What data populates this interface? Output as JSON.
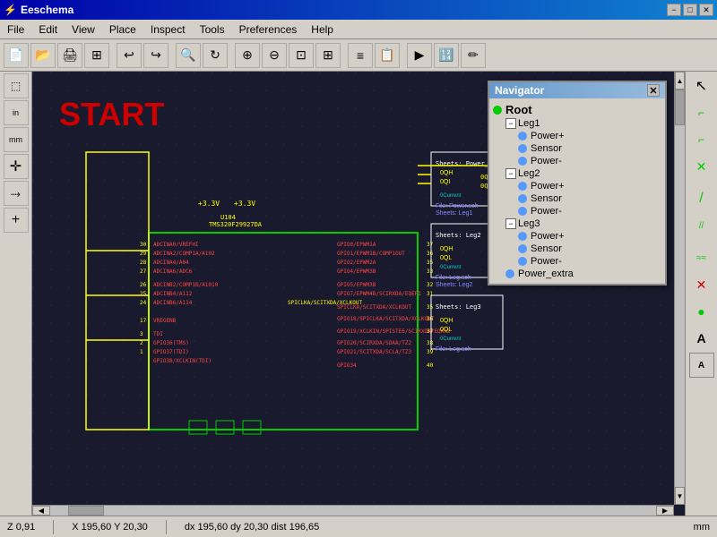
{
  "titlebar": {
    "title": "Eeschema",
    "min_btn": "−",
    "max_btn": "□",
    "close_btn": "✕"
  },
  "menubar": {
    "items": [
      "File",
      "Edit",
      "View",
      "Place",
      "Inspect",
      "Tools",
      "Preferences",
      "Help"
    ]
  },
  "toolbar": {
    "buttons": [
      {
        "name": "new",
        "icon": "📄"
      },
      {
        "name": "open",
        "icon": "📂"
      },
      {
        "name": "print",
        "icon": "🖨"
      },
      {
        "name": "copy",
        "icon": "⊞"
      },
      {
        "name": "sep1",
        "icon": ""
      },
      {
        "name": "undo",
        "icon": "↩"
      },
      {
        "name": "redo",
        "icon": "↪"
      },
      {
        "name": "sep2",
        "icon": ""
      },
      {
        "name": "search",
        "icon": "🔍"
      },
      {
        "name": "refresh",
        "icon": "↻"
      },
      {
        "name": "sep3",
        "icon": ""
      },
      {
        "name": "zoom-in",
        "icon": "⊕"
      },
      {
        "name": "zoom-out",
        "icon": "⊖"
      },
      {
        "name": "zoom-fit",
        "icon": "⊡"
      },
      {
        "name": "zoom-sel",
        "icon": "⊞"
      },
      {
        "name": "sep4",
        "icon": ""
      },
      {
        "name": "netlist",
        "icon": "≡"
      },
      {
        "name": "bom",
        "icon": "📋"
      },
      {
        "name": "sep5",
        "icon": ""
      },
      {
        "name": "erc",
        "icon": "▶"
      },
      {
        "name": "annotate",
        "icon": "🔢"
      },
      {
        "name": "edit-fields",
        "icon": "✏"
      }
    ]
  },
  "left_toolbar": {
    "buttons": [
      {
        "name": "select",
        "icon": "⬚"
      },
      {
        "name": "unit-in",
        "icon": "in"
      },
      {
        "name": "unit-mm",
        "icon": "mm"
      },
      {
        "name": "sep1",
        "icon": ""
      },
      {
        "name": "move",
        "icon": "✛"
      },
      {
        "name": "wire",
        "icon": "→"
      },
      {
        "name": "add-junction",
        "icon": "+"
      }
    ]
  },
  "right_toolbar": {
    "buttons": [
      {
        "name": "cursor",
        "icon": "↖"
      },
      {
        "name": "wire-tool",
        "icon": "⌐"
      },
      {
        "name": "bus-tool",
        "icon": "⌐"
      },
      {
        "name": "no-connect",
        "icon": "✕"
      },
      {
        "name": "sep1",
        "icon": ""
      },
      {
        "name": "add-wire",
        "icon": "/"
      },
      {
        "name": "add-bus",
        "icon": "//"
      },
      {
        "name": "sep2",
        "icon": ""
      },
      {
        "name": "add-global",
        "icon": "≈"
      },
      {
        "name": "cross",
        "icon": "✕"
      },
      {
        "name": "dot",
        "icon": "●"
      },
      {
        "name": "text",
        "icon": "A"
      },
      {
        "name": "text2",
        "icon": "A"
      }
    ]
  },
  "navigator": {
    "title": "Navigator",
    "close_label": "✕",
    "items": [
      {
        "id": "root",
        "label": "Root",
        "level": 0,
        "dot_color": "#00cc00",
        "has_expand": false,
        "expanded": true
      },
      {
        "id": "leg1",
        "label": "Leg1",
        "level": 1,
        "dot_color": null,
        "has_expand": true,
        "expanded": true
      },
      {
        "id": "leg1-power+",
        "label": "Power+",
        "level": 2,
        "dot_color": "#5599ff",
        "has_expand": false
      },
      {
        "id": "leg1-sensor",
        "label": "Sensor",
        "level": 2,
        "dot_color": "#5599ff",
        "has_expand": false
      },
      {
        "id": "leg1-power-",
        "label": "Power-",
        "level": 2,
        "dot_color": "#5599ff",
        "has_expand": false
      },
      {
        "id": "leg2",
        "label": "Leg2",
        "level": 1,
        "dot_color": null,
        "has_expand": true,
        "expanded": true
      },
      {
        "id": "leg2-power+",
        "label": "Power+",
        "level": 2,
        "dot_color": "#5599ff",
        "has_expand": false
      },
      {
        "id": "leg2-sensor",
        "label": "Sensor",
        "level": 2,
        "dot_color": "#5599ff",
        "has_expand": false
      },
      {
        "id": "leg2-power-",
        "label": "Power-",
        "level": 2,
        "dot_color": "#5599ff",
        "has_expand": false
      },
      {
        "id": "leg3",
        "label": "Leg3",
        "level": 1,
        "dot_color": null,
        "has_expand": true,
        "expanded": true
      },
      {
        "id": "leg3-power+",
        "label": "Power+",
        "level": 2,
        "dot_color": "#5599ff",
        "has_expand": false
      },
      {
        "id": "leg3-sensor",
        "label": "Sensor",
        "level": 2,
        "dot_color": "#5599ff",
        "has_expand": false
      },
      {
        "id": "leg3-power-",
        "label": "Power-",
        "level": 2,
        "dot_color": "#5599ff",
        "has_expand": false
      },
      {
        "id": "power-extra",
        "label": "Power_extra",
        "level": 1,
        "dot_color": "#5599ff",
        "has_expand": false
      }
    ]
  },
  "statusbar": {
    "zoom": "Z 0,91",
    "coords": "X 195,60  Y 20,30",
    "dx": "dx 195,60  dy 20,30  dist 196,65",
    "unit": "mm"
  },
  "schematic": {
    "start_label": "START",
    "chip_label": "TMS320F29927DA",
    "voltage1": "+3.3V",
    "voltage2": "+3.3V",
    "diode": "U104"
  }
}
